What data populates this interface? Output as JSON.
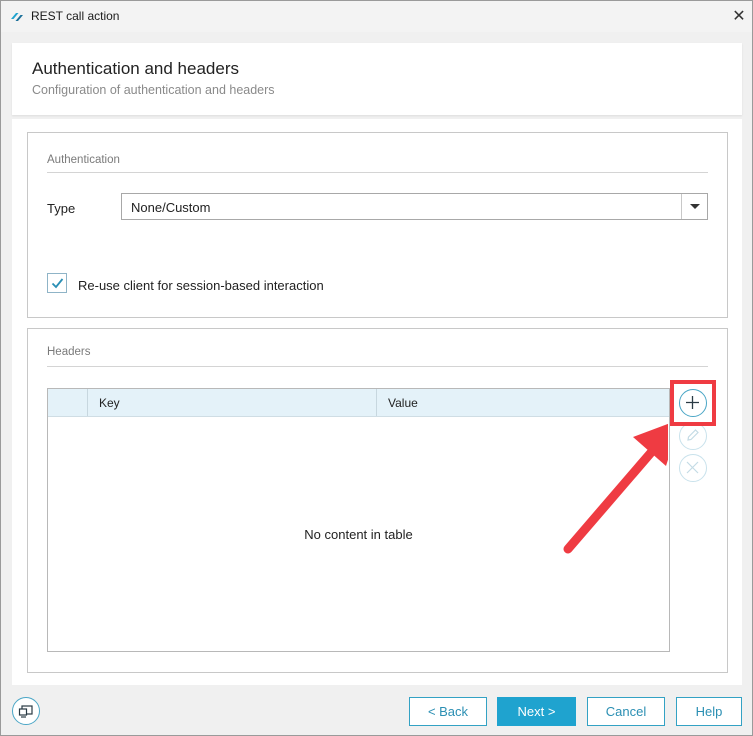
{
  "window": {
    "title": "REST call action",
    "app_icon": "double-chevron-logo-icon",
    "close_icon": "close-icon"
  },
  "header": {
    "title": "Authentication and headers",
    "subtitle": "Configuration of authentication and headers"
  },
  "authentication": {
    "section_label": "Authentication",
    "type_label": "Type",
    "type_value": "None/Custom",
    "reuse_checked": true,
    "reuse_label": "Re-use client for session-based interaction"
  },
  "headers": {
    "section_label": "Headers",
    "columns": [
      "Key",
      "Value"
    ],
    "rows": [],
    "empty_message": "No content in table",
    "actions": [
      {
        "icon": "plus-icon",
        "enabled": true,
        "highlighted": true
      },
      {
        "icon": "pencil-icon",
        "enabled": false
      },
      {
        "icon": "close-circle-icon",
        "enabled": false
      }
    ]
  },
  "footer": {
    "back": "< Back",
    "next": "Next >",
    "cancel": "Cancel",
    "help": "Help"
  },
  "colors": {
    "accent": "#1fa3cf",
    "header_row": "#e4f2f9",
    "annotation": "#ef3b42"
  }
}
